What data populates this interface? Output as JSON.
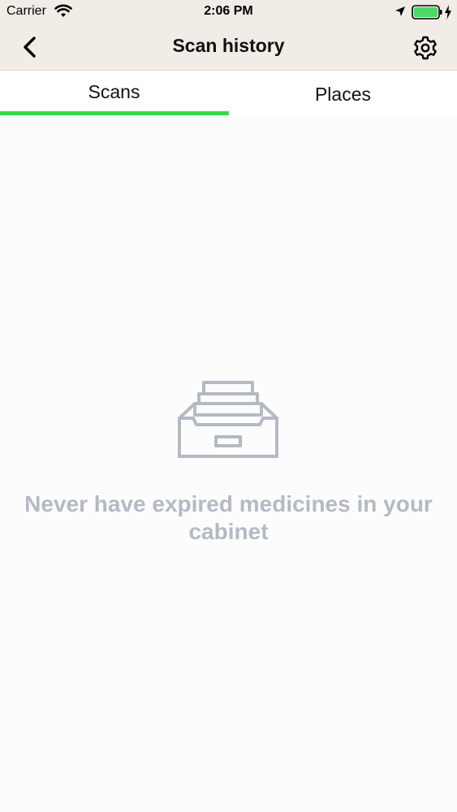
{
  "status_bar": {
    "carrier": "Carrier",
    "time": "2:06 PM",
    "battery_color": "#4cd964"
  },
  "nav": {
    "title": "Scan history",
    "back_icon": "chevron-left-icon",
    "settings_icon": "gear-icon"
  },
  "tabs": [
    {
      "label": "Scans",
      "active": true
    },
    {
      "label": "Places",
      "active": false
    }
  ],
  "accent_color": "#3ad64a",
  "empty_state": {
    "icon": "archive-drawer-icon",
    "message": "Never have expired medicines in your cabinet"
  }
}
